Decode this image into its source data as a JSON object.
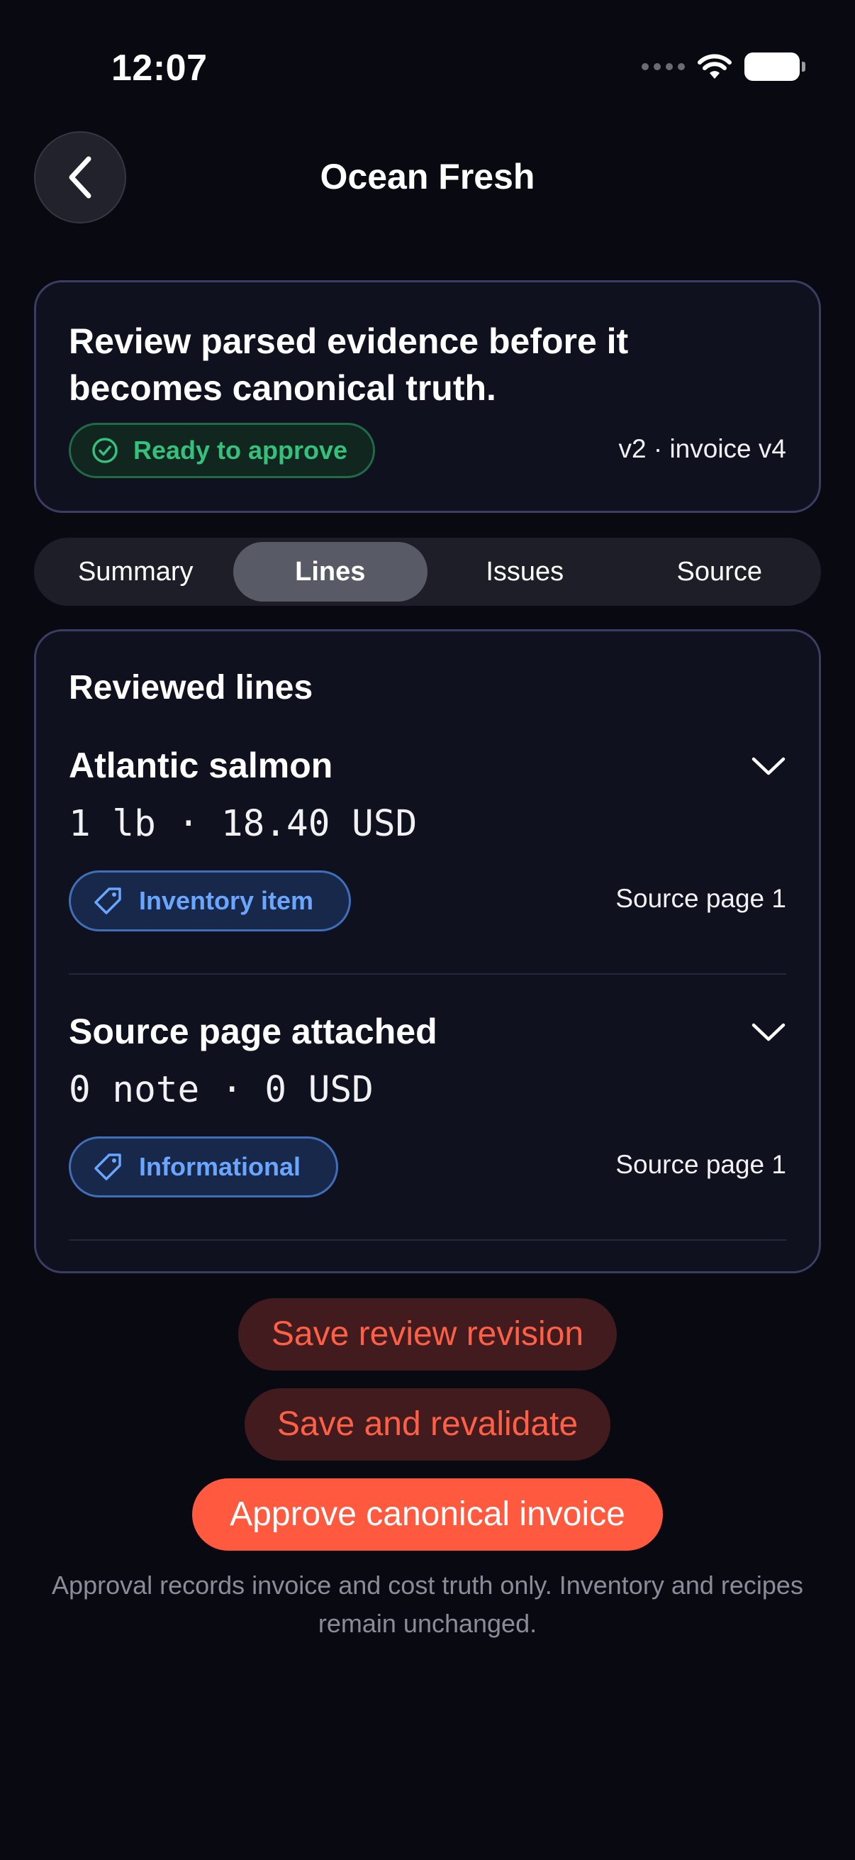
{
  "status_bar": {
    "time": "12:07"
  },
  "header": {
    "title": "Ocean Fresh",
    "back_icon": "chevron-left-icon"
  },
  "info_card": {
    "headline": "Review parsed evidence before it becomes canonical truth.",
    "status_badge": "Ready to approve",
    "version": "v2 · invoice v4",
    "colors": {
      "success": "#35c07c"
    }
  },
  "tabs": [
    {
      "label": "Summary",
      "active": false
    },
    {
      "label": "Lines",
      "active": true
    },
    {
      "label": "Issues",
      "active": false
    },
    {
      "label": "Source",
      "active": false
    }
  ],
  "lines": {
    "section_title": "Reviewed lines",
    "items": [
      {
        "name": "Atlantic salmon",
        "meta": "1 lb · 18.40 USD",
        "tag": "Inventory item",
        "source": "Source page 1"
      },
      {
        "name": "Source page attached",
        "meta": "0 note · 0 USD",
        "tag": "Informational",
        "source": "Source page 1"
      }
    ]
  },
  "actions": {
    "save_revision": "Save review revision",
    "save_revalidate": "Save and revalidate",
    "approve": "Approve canonical invoice",
    "footnote": "Approval records invoice and cost truth only. Inventory and recipes remain unchanged.",
    "colors": {
      "accent": "#ff5a3f"
    }
  }
}
